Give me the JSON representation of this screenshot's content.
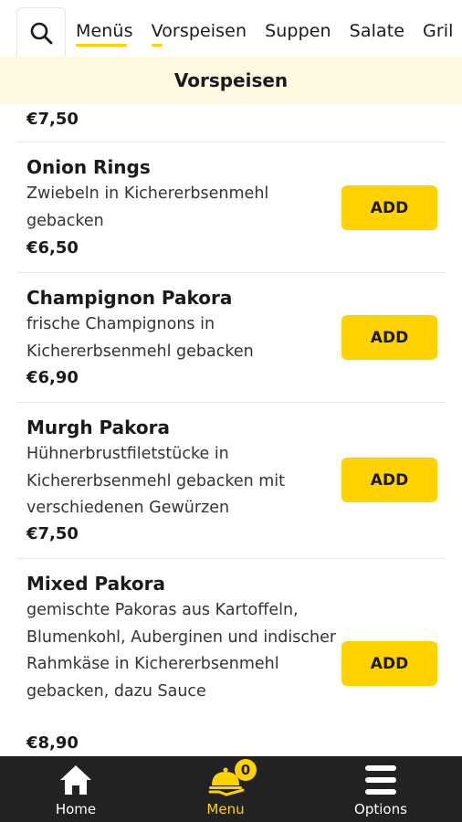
{
  "tabs": [
    {
      "label": "Menüs"
    },
    {
      "label": "Vorspeisen"
    },
    {
      "label": "Suppen"
    },
    {
      "label": "Salate"
    },
    {
      "label": "Gril"
    }
  ],
  "section_title": "Vorspeisen",
  "prev_item_price": "€7,50",
  "items": [
    {
      "name": "Onion Rings",
      "description": "Zwiebeln in Kichererbsenmehl gebacken",
      "price": "€6,50",
      "add_label": "ADD"
    },
    {
      "name": "Champignon Pakora",
      "description": "frische Champignons in Kichererbsenmehl gebacken",
      "price": "€6,90",
      "add_label": "ADD"
    },
    {
      "name": "Murgh Pakora",
      "description": "Hühnerbrustfiletstücke in Kichererbsenmehl gebacken mit verschiedenen Gewürzen",
      "price": "€7,50",
      "add_label": "ADD"
    },
    {
      "name": "Mixed Pakora",
      "description": "gemischte Pakoras aus Kartoffeln, Blumenkohl, Auberginen und indischer Rahmkäse in Kichererbsenmehl gebacken, dazu Sauce",
      "price": "€8,90",
      "add_label": "ADD"
    }
  ],
  "nav": {
    "home": {
      "label": "Home",
      "icon": "home-icon"
    },
    "menu": {
      "label": "Menu",
      "icon": "cloche-icon",
      "badge": "0"
    },
    "options": {
      "label": "Options",
      "icon": "hamburger-icon"
    }
  },
  "colors": {
    "accent": "#ffd200",
    "section_bg": "#fdf8e2",
    "nav_bg": "#222222"
  }
}
